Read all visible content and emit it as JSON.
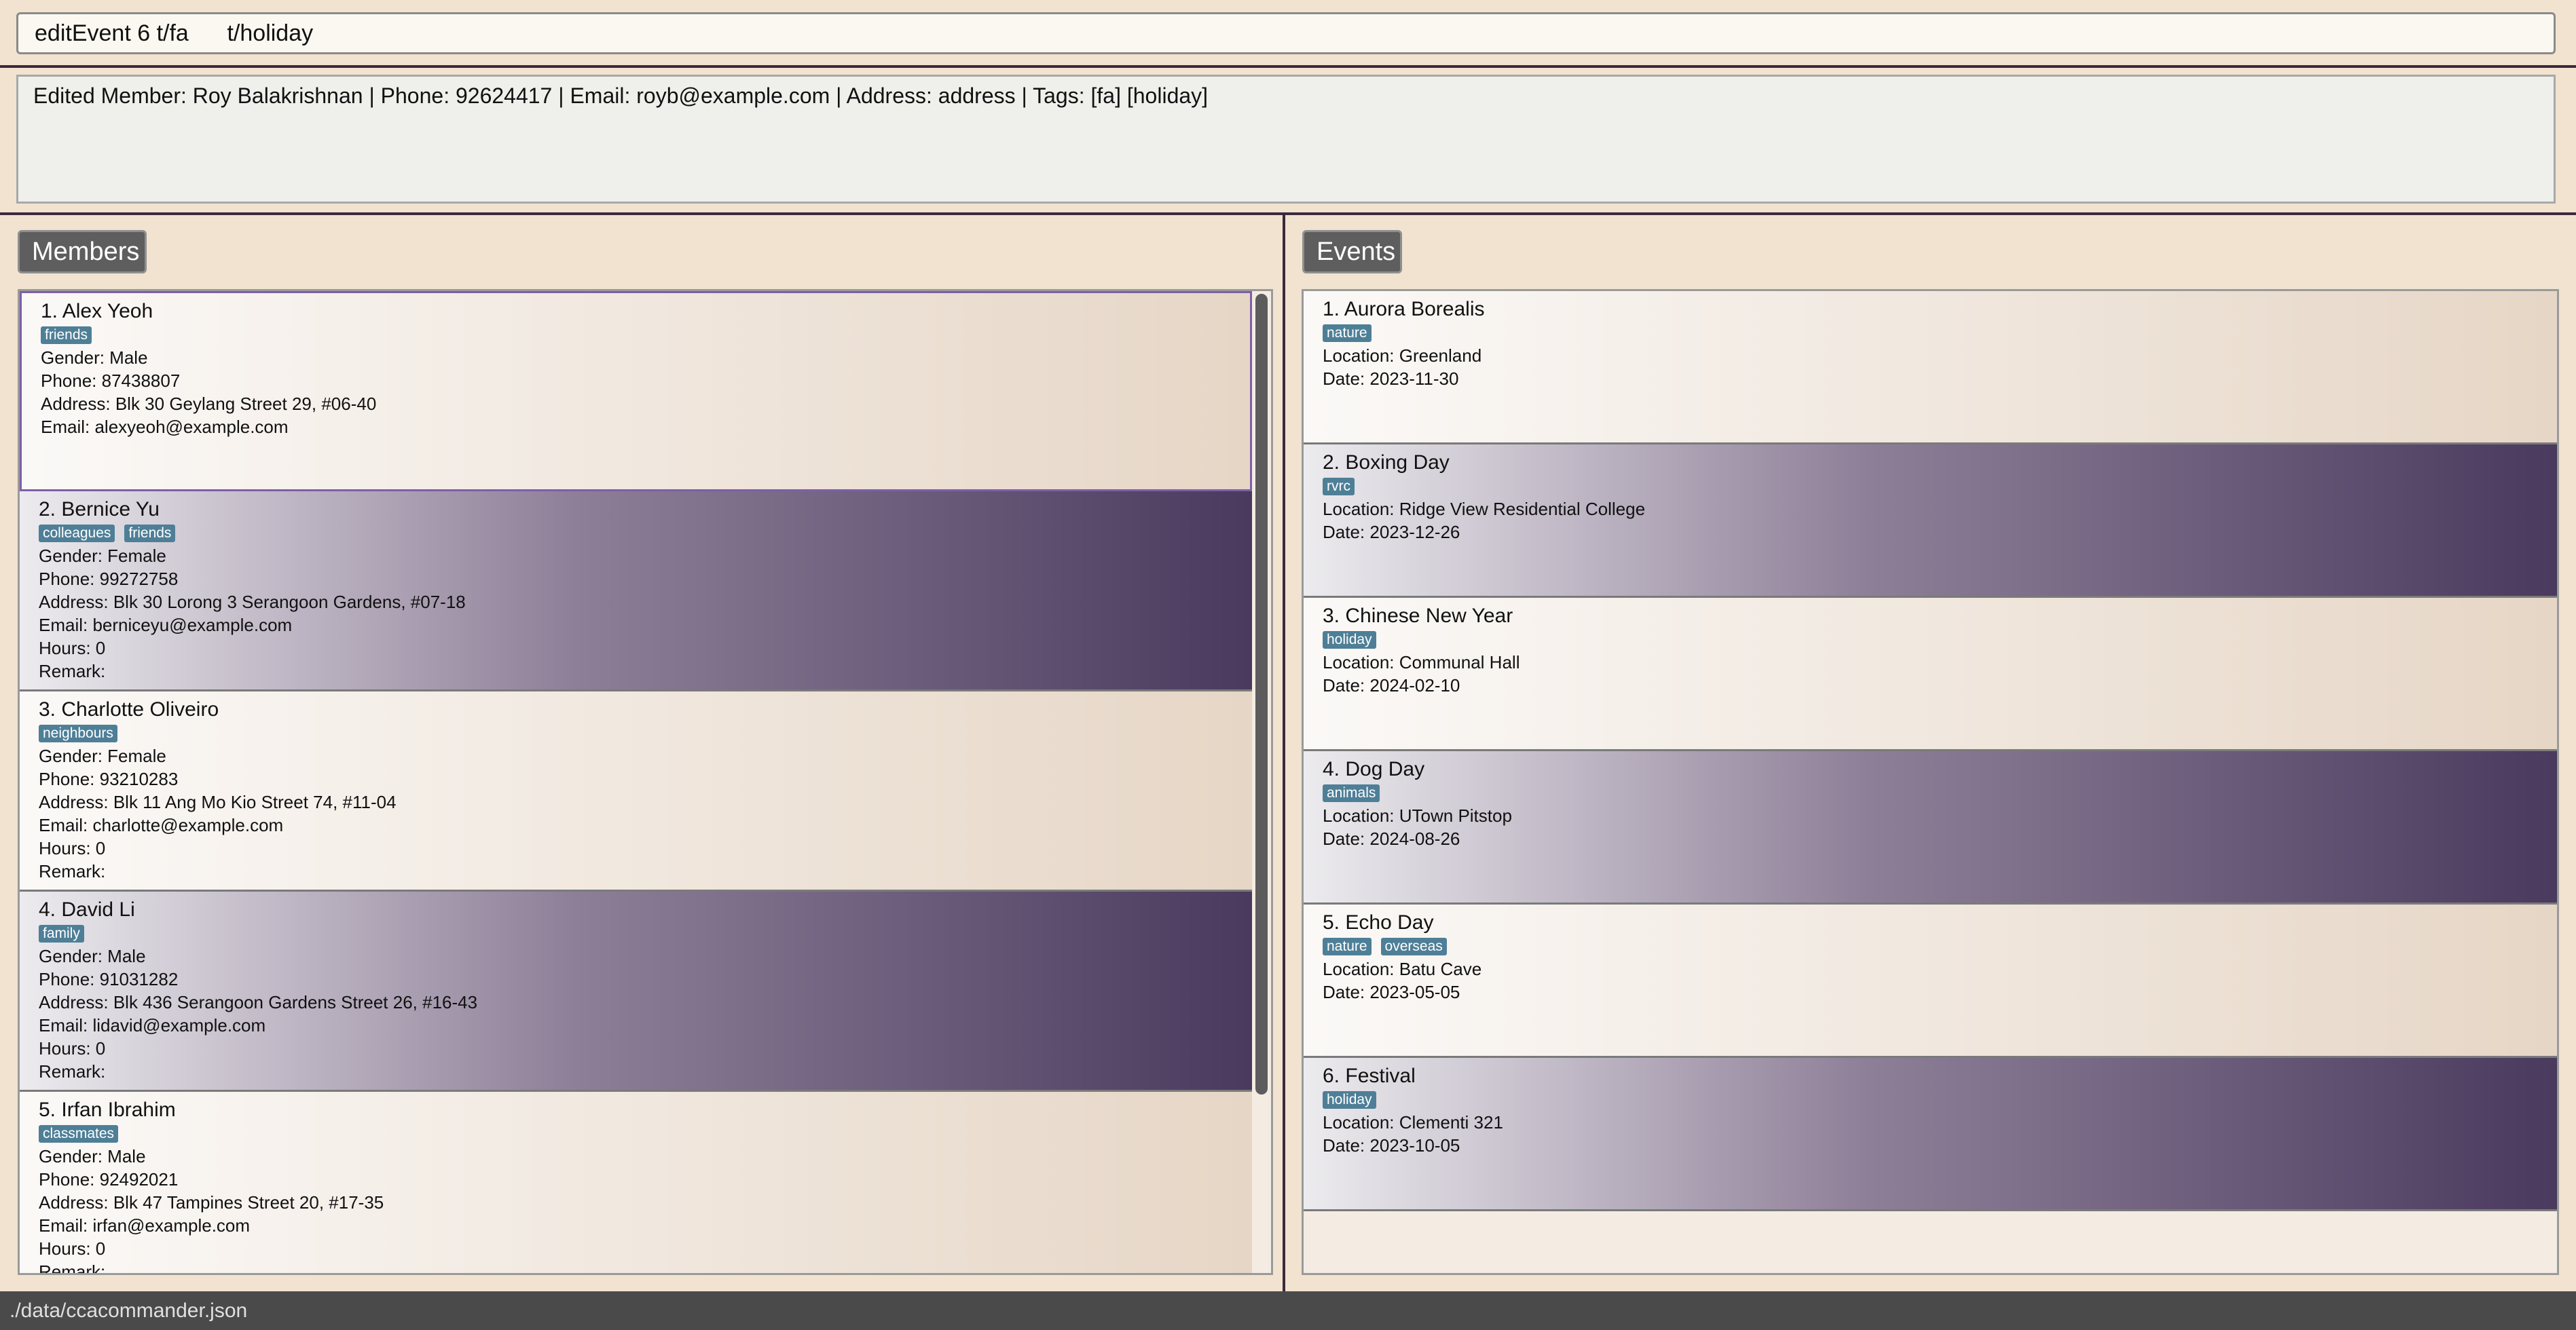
{
  "command": {
    "value": "editEvent 6 t/fa      t/holiday"
  },
  "result": {
    "text": "Edited Member: Roy Balakrishnan | Phone: 92624417 | Email: royb@example.com | Address: address | Tags: [fa] [holiday]"
  },
  "members": {
    "title": "Members",
    "items": [
      {
        "index": "1.",
        "name": "Alex Yeoh",
        "tags": [
          "friends"
        ],
        "gender": "Gender: Male",
        "phone": "Phone: 87438807",
        "address": "Address: Blk 30 Geylang Street 29, #06-40",
        "email": "Email: alexyeoh@example.com",
        "hours": "",
        "remark": ""
      },
      {
        "index": "2.",
        "name": "Bernice Yu",
        "tags": [
          "colleagues",
          "friends"
        ],
        "gender": "Gender: Female",
        "phone": "Phone: 99272758",
        "address": "Address: Blk 30 Lorong 3 Serangoon Gardens, #07-18",
        "email": "Email: berniceyu@example.com",
        "hours": "Hours: 0",
        "remark": "Remark:"
      },
      {
        "index": "3.",
        "name": "Charlotte Oliveiro",
        "tags": [
          "neighbours"
        ],
        "gender": "Gender: Female",
        "phone": "Phone: 93210283",
        "address": "Address: Blk 11 Ang Mo Kio Street 74, #11-04",
        "email": "Email: charlotte@example.com",
        "hours": "Hours: 0",
        "remark": "Remark:"
      },
      {
        "index": "4.",
        "name": "David Li",
        "tags": [
          "family"
        ],
        "gender": "Gender: Male",
        "phone": "Phone: 91031282",
        "address": "Address: Blk 436 Serangoon Gardens Street 26, #16-43",
        "email": "Email: lidavid@example.com",
        "hours": "Hours: 0",
        "remark": "Remark:"
      },
      {
        "index": "5.",
        "name": "Irfan Ibrahim",
        "tags": [
          "classmates"
        ],
        "gender": "Gender: Male",
        "phone": "Phone: 92492021",
        "address": "Address: Blk 47 Tampines Street 20, #17-35",
        "email": "Email: irfan@example.com",
        "hours": "Hours: 0",
        "remark": "Remark:"
      }
    ]
  },
  "events": {
    "title": "Events",
    "items": [
      {
        "index": "1.",
        "name": "Aurora Borealis",
        "tags": [
          "nature"
        ],
        "location": "Location: Greenland",
        "date": "Date: 2023-11-30"
      },
      {
        "index": "2.",
        "name": "Boxing Day",
        "tags": [
          "rvrc"
        ],
        "location": "Location: Ridge View Residential College",
        "date": "Date: 2023-12-26"
      },
      {
        "index": "3.",
        "name": "Chinese New Year",
        "tags": [
          "holiday"
        ],
        "location": "Location: Communal Hall",
        "date": "Date: 2024-02-10"
      },
      {
        "index": "4.",
        "name": "Dog Day",
        "tags": [
          "animals"
        ],
        "location": "Location: UTown Pitstop",
        "date": "Date: 2024-08-26"
      },
      {
        "index": "5.",
        "name": "Echo Day",
        "tags": [
          "nature",
          "overseas"
        ],
        "location": "Location: Batu Cave",
        "date": "Date: 2023-05-05"
      },
      {
        "index": "6.",
        "name": "Festival",
        "tags": [
          "holiday"
        ],
        "location": "Location: Clementi 321",
        "date": "Date: 2023-10-05"
      }
    ]
  },
  "status": {
    "path": "./data/ccacommander.json"
  }
}
